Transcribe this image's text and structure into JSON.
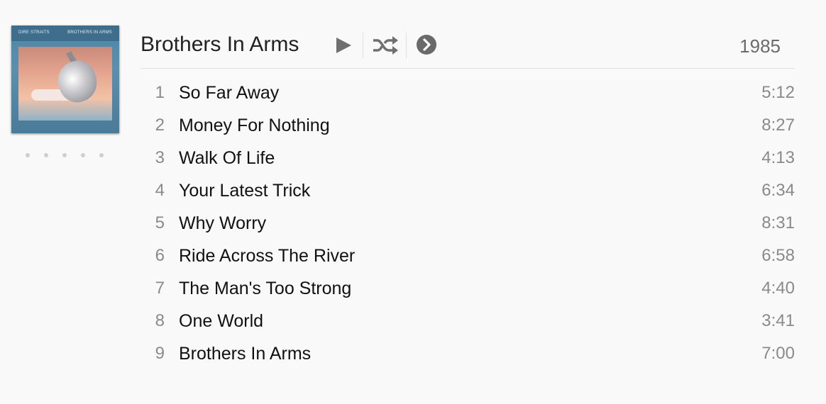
{
  "album": {
    "cover_artist": "DIRE STRAITS",
    "cover_title": "BROTHERS IN ARMS",
    "title": "Brothers In Arms",
    "year": "1985",
    "rating_stars": 5,
    "rating_value": 0
  },
  "controls": {
    "play_icon": "play-icon",
    "shuffle_icon": "shuffle-icon",
    "more_icon": "chevron-right-circle-icon"
  },
  "tracks": [
    {
      "number": "1",
      "title": "So Far Away",
      "duration": "5:12"
    },
    {
      "number": "2",
      "title": "Money For Nothing",
      "duration": "8:27"
    },
    {
      "number": "3",
      "title": "Walk Of Life",
      "duration": "4:13"
    },
    {
      "number": "4",
      "title": "Your Latest Trick",
      "duration": "6:34"
    },
    {
      "number": "5",
      "title": "Why Worry",
      "duration": "8:31"
    },
    {
      "number": "6",
      "title": "Ride Across The River",
      "duration": "6:58"
    },
    {
      "number": "7",
      "title": "The Man's Too Strong",
      "duration": "4:40"
    },
    {
      "number": "8",
      "title": "One World",
      "duration": "3:41"
    },
    {
      "number": "9",
      "title": "Brothers In Arms",
      "duration": "7:00"
    }
  ],
  "colors": {
    "background": "#f9f9f9",
    "icon": "#6f6f6f",
    "secondary_text": "#8a8a8a"
  }
}
